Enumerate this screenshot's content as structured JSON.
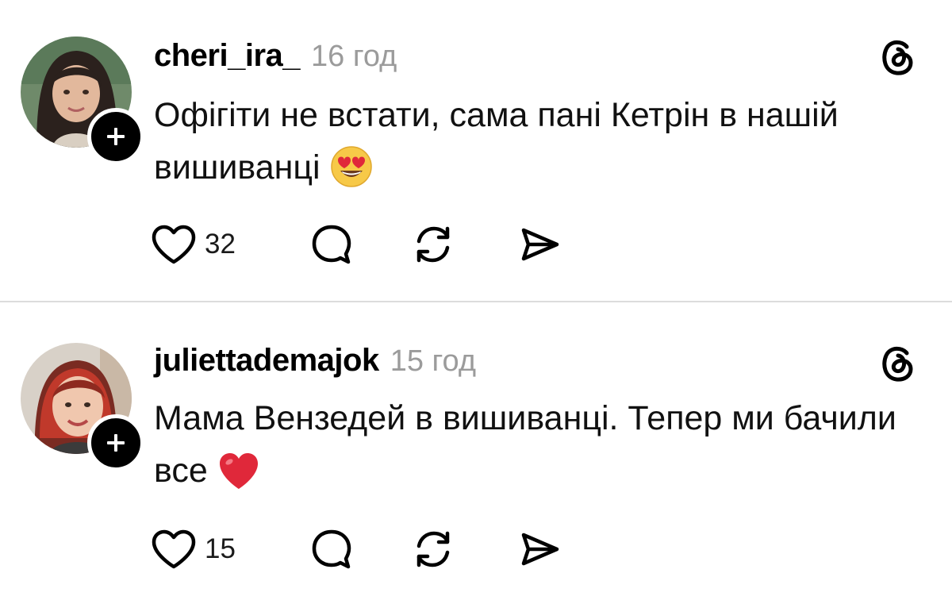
{
  "posts": [
    {
      "username": "cheri_ira_",
      "time": "16 год",
      "text": "Офігіти не встати, сама пані Кетрін в нашій вишиванці",
      "emoji": "smiling-face-with-heart-eyes",
      "likes": "32",
      "avatar": "avatar-photo",
      "platform_icon": "threads-icon"
    },
    {
      "username": "juliettademajok",
      "time": "15 год",
      "text": "Мама Вензедей в вишиванці. Тепер ми бачили все",
      "emoji": "red-heart",
      "likes": "15",
      "avatar": "avatar-photo",
      "platform_icon": "threads-icon"
    }
  ],
  "icons": {
    "like": "heart-outline-icon",
    "comment": "speech-bubble-icon",
    "repost": "repost-arrows-icon",
    "share": "paper-plane-icon",
    "follow": "plus-icon"
  },
  "colors": {
    "text": "#000000",
    "timestamp": "#9b9b9b",
    "divider": "#dcdcdc",
    "heart_emoji": "#e0283a",
    "face_emoji": "#f7c948"
  }
}
